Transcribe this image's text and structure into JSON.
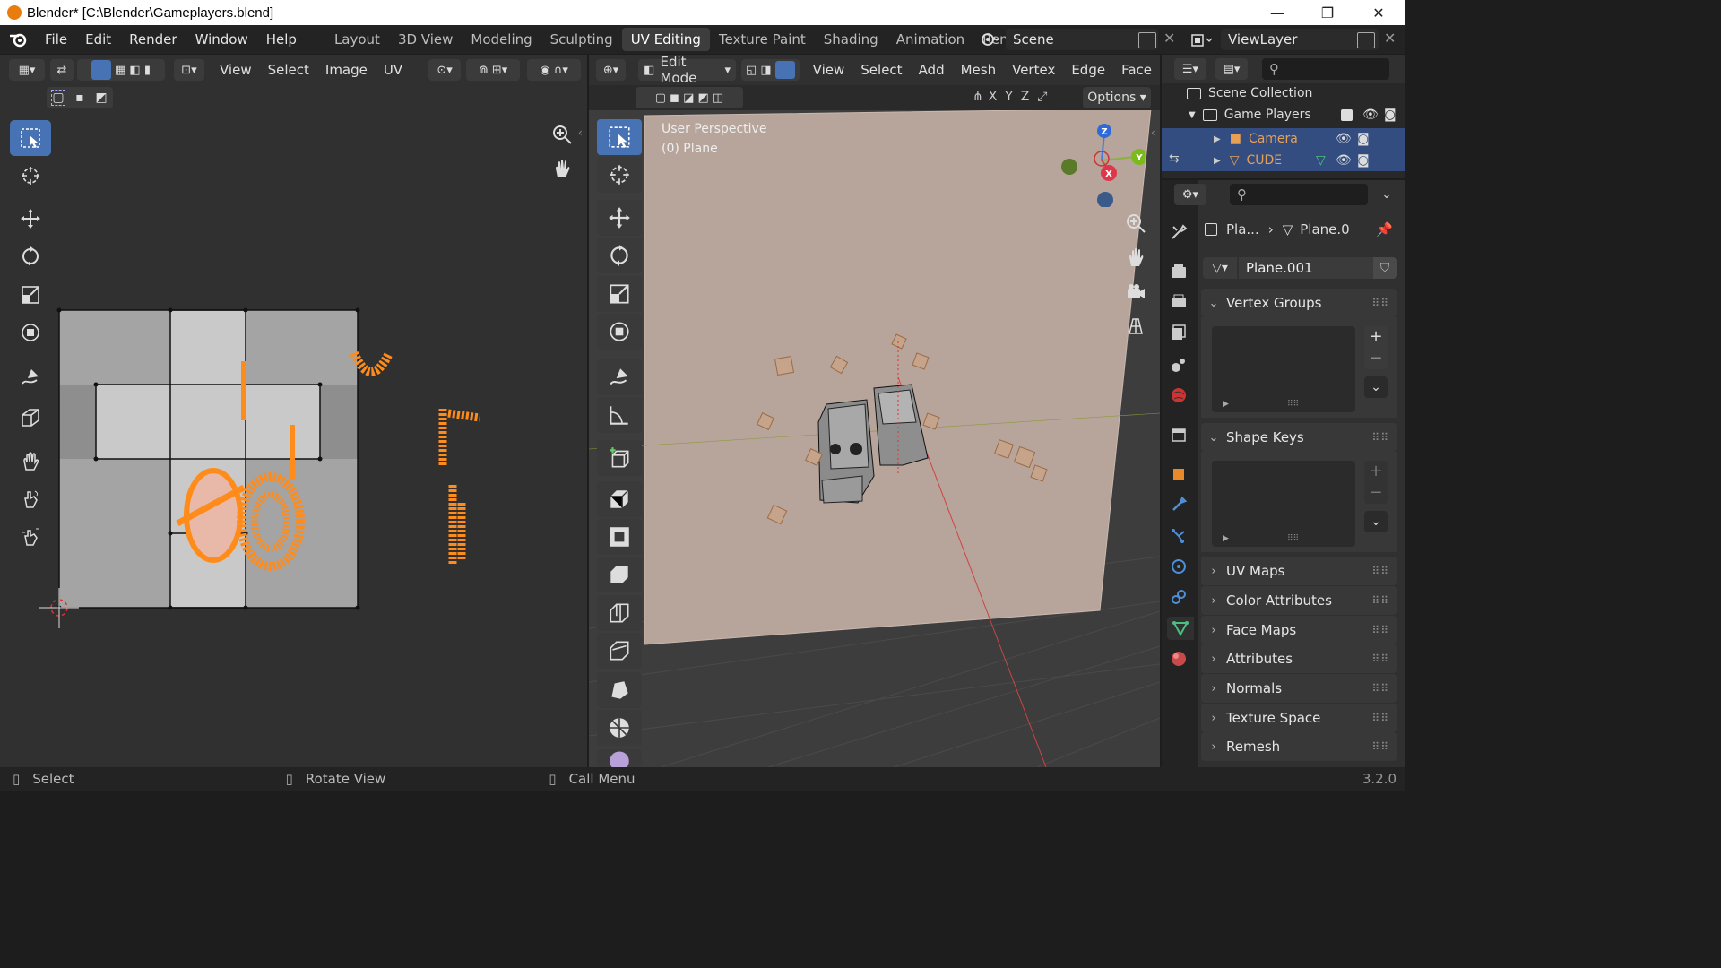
{
  "window": {
    "title": "Blender* [C:\\Blender\\Gameplayers.blend]",
    "minimize": "—",
    "maximize": "❐",
    "close": "✕"
  },
  "menus": [
    "File",
    "Edit",
    "Render",
    "Window",
    "Help"
  ],
  "workspaces": [
    "Layout",
    "3D View",
    "Modeling",
    "Sculpting",
    "UV Editing",
    "Texture Paint",
    "Shading",
    "Animation",
    "Renderin"
  ],
  "active_workspace": "UV Editing",
  "scene": {
    "name": "Scene"
  },
  "view_layer": {
    "name": "ViewLayer"
  },
  "uv_editor": {
    "menus": [
      "View",
      "Select",
      "Image",
      "UV"
    ]
  },
  "viewport": {
    "mode": "Edit Mode",
    "menus": [
      "View",
      "Select",
      "Add",
      "Mesh",
      "Vertex",
      "Edge",
      "Face"
    ],
    "axes": [
      "X",
      "Y",
      "Z"
    ],
    "options": "Options",
    "overlay_line1": "User Perspective",
    "overlay_line2": "(0) Plane",
    "gizmo": {
      "z": "Z",
      "y": "Y",
      "x": "X"
    }
  },
  "outliner": {
    "root": "Scene Collection",
    "collection": "Game Players",
    "items": [
      {
        "name": "Camera",
        "color": "#e8a055"
      },
      {
        "name": "CUDE",
        "color": "#e8a055"
      }
    ]
  },
  "properties": {
    "breadcrumb_object": "Pla...",
    "breadcrumb_data": "Plane.0",
    "mesh_name": "Plane.001",
    "panels_open": [
      "Vertex Groups",
      "Shape Keys"
    ],
    "panels_closed": [
      "UV Maps",
      "Color Attributes",
      "Face Maps",
      "Attributes",
      "Normals",
      "Texture Space",
      "Remesh"
    ]
  },
  "statusbar": {
    "select": "Select",
    "rotate": "Rotate View",
    "call_menu": "Call Menu",
    "version": "3.2.0"
  },
  "colors": {
    "accent": "#4772b3",
    "selection": "#ff8c1a",
    "background": "#303030"
  }
}
